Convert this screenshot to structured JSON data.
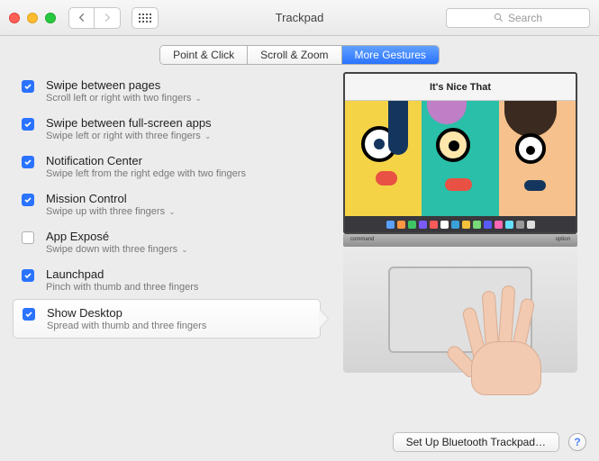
{
  "window": {
    "title": "Trackpad"
  },
  "search": {
    "placeholder": "Search"
  },
  "tabs": [
    {
      "label": "Point & Click",
      "selected": false
    },
    {
      "label": "Scroll & Zoom",
      "selected": false
    },
    {
      "label": "More Gestures",
      "selected": true
    }
  ],
  "gestures": [
    {
      "title": "Swipe between pages",
      "sub": "Scroll left or right with two fingers",
      "checked": true,
      "dropdown": true,
      "selected": false
    },
    {
      "title": "Swipe between full-screen apps",
      "sub": "Swipe left or right with three fingers",
      "checked": true,
      "dropdown": true,
      "selected": false
    },
    {
      "title": "Notification Center",
      "sub": "Swipe left from the right edge with two fingers",
      "checked": true,
      "dropdown": false,
      "selected": false
    },
    {
      "title": "Mission Control",
      "sub": "Swipe up with three fingers",
      "checked": true,
      "dropdown": true,
      "selected": false
    },
    {
      "title": "App Exposé",
      "sub": "Swipe down with three fingers",
      "checked": false,
      "dropdown": true,
      "selected": false
    },
    {
      "title": "Launchpad",
      "sub": "Pinch with thumb and three fingers",
      "checked": true,
      "dropdown": false,
      "selected": false
    },
    {
      "title": "Show Desktop",
      "sub": "Spread with thumb and three fingers",
      "checked": true,
      "dropdown": false,
      "selected": true
    }
  ],
  "preview": {
    "site_title": "It's Nice That",
    "key_left": "command",
    "key_right": "option",
    "dock_colors": [
      "#5aa0ff",
      "#ff9744",
      "#3fc562",
      "#7b5bff",
      "#ff5a5a",
      "#ffffff",
      "#3aa2d9",
      "#f3c13a",
      "#77d977",
      "#5a5aff",
      "#ff66b3",
      "#66e0ff",
      "#999999",
      "#dedede"
    ]
  },
  "footer": {
    "setup_button": "Set Up Bluetooth Trackpad…",
    "help": "?"
  }
}
